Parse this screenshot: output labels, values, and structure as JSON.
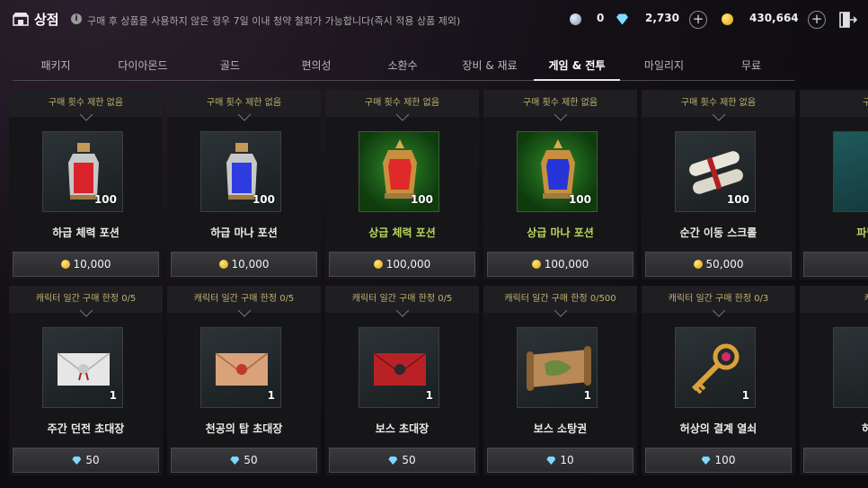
{
  "header": {
    "title": "상점",
    "notice": "구매 후 상품을 사용하지 않은 경우 7일 이내 청약 철회가 가능합니다(즉시 적용 상품 제외)",
    "currency_1_value": "0",
    "diamond_value": "2,730",
    "gold_value": "430,664"
  },
  "tabs": [
    {
      "label": "패키지"
    },
    {
      "label": "다이아몬드"
    },
    {
      "label": "골드"
    },
    {
      "label": "편의성"
    },
    {
      "label": "소환수"
    },
    {
      "label": "장비 & 재료"
    },
    {
      "label": "게임 & 전투",
      "active": true
    },
    {
      "label": "마일리지"
    },
    {
      "label": "무료"
    }
  ],
  "row1": [
    {
      "limit": "구매 횟수 제한 없음",
      "name": "하급 체력 포션",
      "qty": "100",
      "price": "10,000",
      "currency": "gold",
      "icon": "red-potion-icon"
    },
    {
      "limit": "구매 횟수 제한 없음",
      "name": "하급 마나 포션",
      "qty": "100",
      "price": "10,000",
      "currency": "gold",
      "icon": "blue-potion-icon"
    },
    {
      "limit": "구매 횟수 제한 없음",
      "name": "상급 체력 포션",
      "qty": "100",
      "price": "100,000",
      "currency": "gold",
      "icon": "red-lantern-potion-icon"
    },
    {
      "limit": "구매 횟수 제한 없음",
      "name": "상급 마나 포션",
      "qty": "100",
      "price": "100,000",
      "currency": "gold",
      "icon": "blue-lantern-potion-icon"
    },
    {
      "limit": "구매 횟수 제한 없음",
      "name": "순간 이동 스크롤",
      "qty": "100",
      "price": "50,000",
      "currency": "gold",
      "icon": "scroll-icon"
    },
    {
      "limit": "구매 횟",
      "name": "파밍필드",
      "qty": "",
      "price": "",
      "currency": "diamond",
      "icon": "map-scroll-icon"
    }
  ],
  "row2": [
    {
      "limit": "캐릭터 일간 구매 한정 0/5",
      "name": "주간 던전 초대장",
      "qty": "1",
      "price": "50",
      "currency": "diamond",
      "icon": "white-envelope-icon"
    },
    {
      "limit": "캐릭터 일간 구매 한정 0/5",
      "name": "천공의 탑 초대장",
      "qty": "1",
      "price": "50",
      "currency": "diamond",
      "icon": "tan-envelope-icon"
    },
    {
      "limit": "캐릭터 일간 구매 한정 0/5",
      "name": "보스 초대장",
      "qty": "1",
      "price": "50",
      "currency": "diamond",
      "icon": "red-envelope-icon"
    },
    {
      "limit": "캐릭터 일간 구매 한정 0/500",
      "name": "보스 소탕권",
      "qty": "1",
      "price": "10",
      "currency": "diamond",
      "icon": "map-icon"
    },
    {
      "limit": "캐릭터 일간 구매 한정 0/3",
      "name": "허상의 결계 열쇠",
      "qty": "1",
      "price": "100",
      "currency": "diamond",
      "icon": "key-icon"
    },
    {
      "limit": "캐릭터",
      "name": "허상의",
      "qty": "",
      "price": "",
      "currency": "gold",
      "icon": "key-icon"
    }
  ]
}
